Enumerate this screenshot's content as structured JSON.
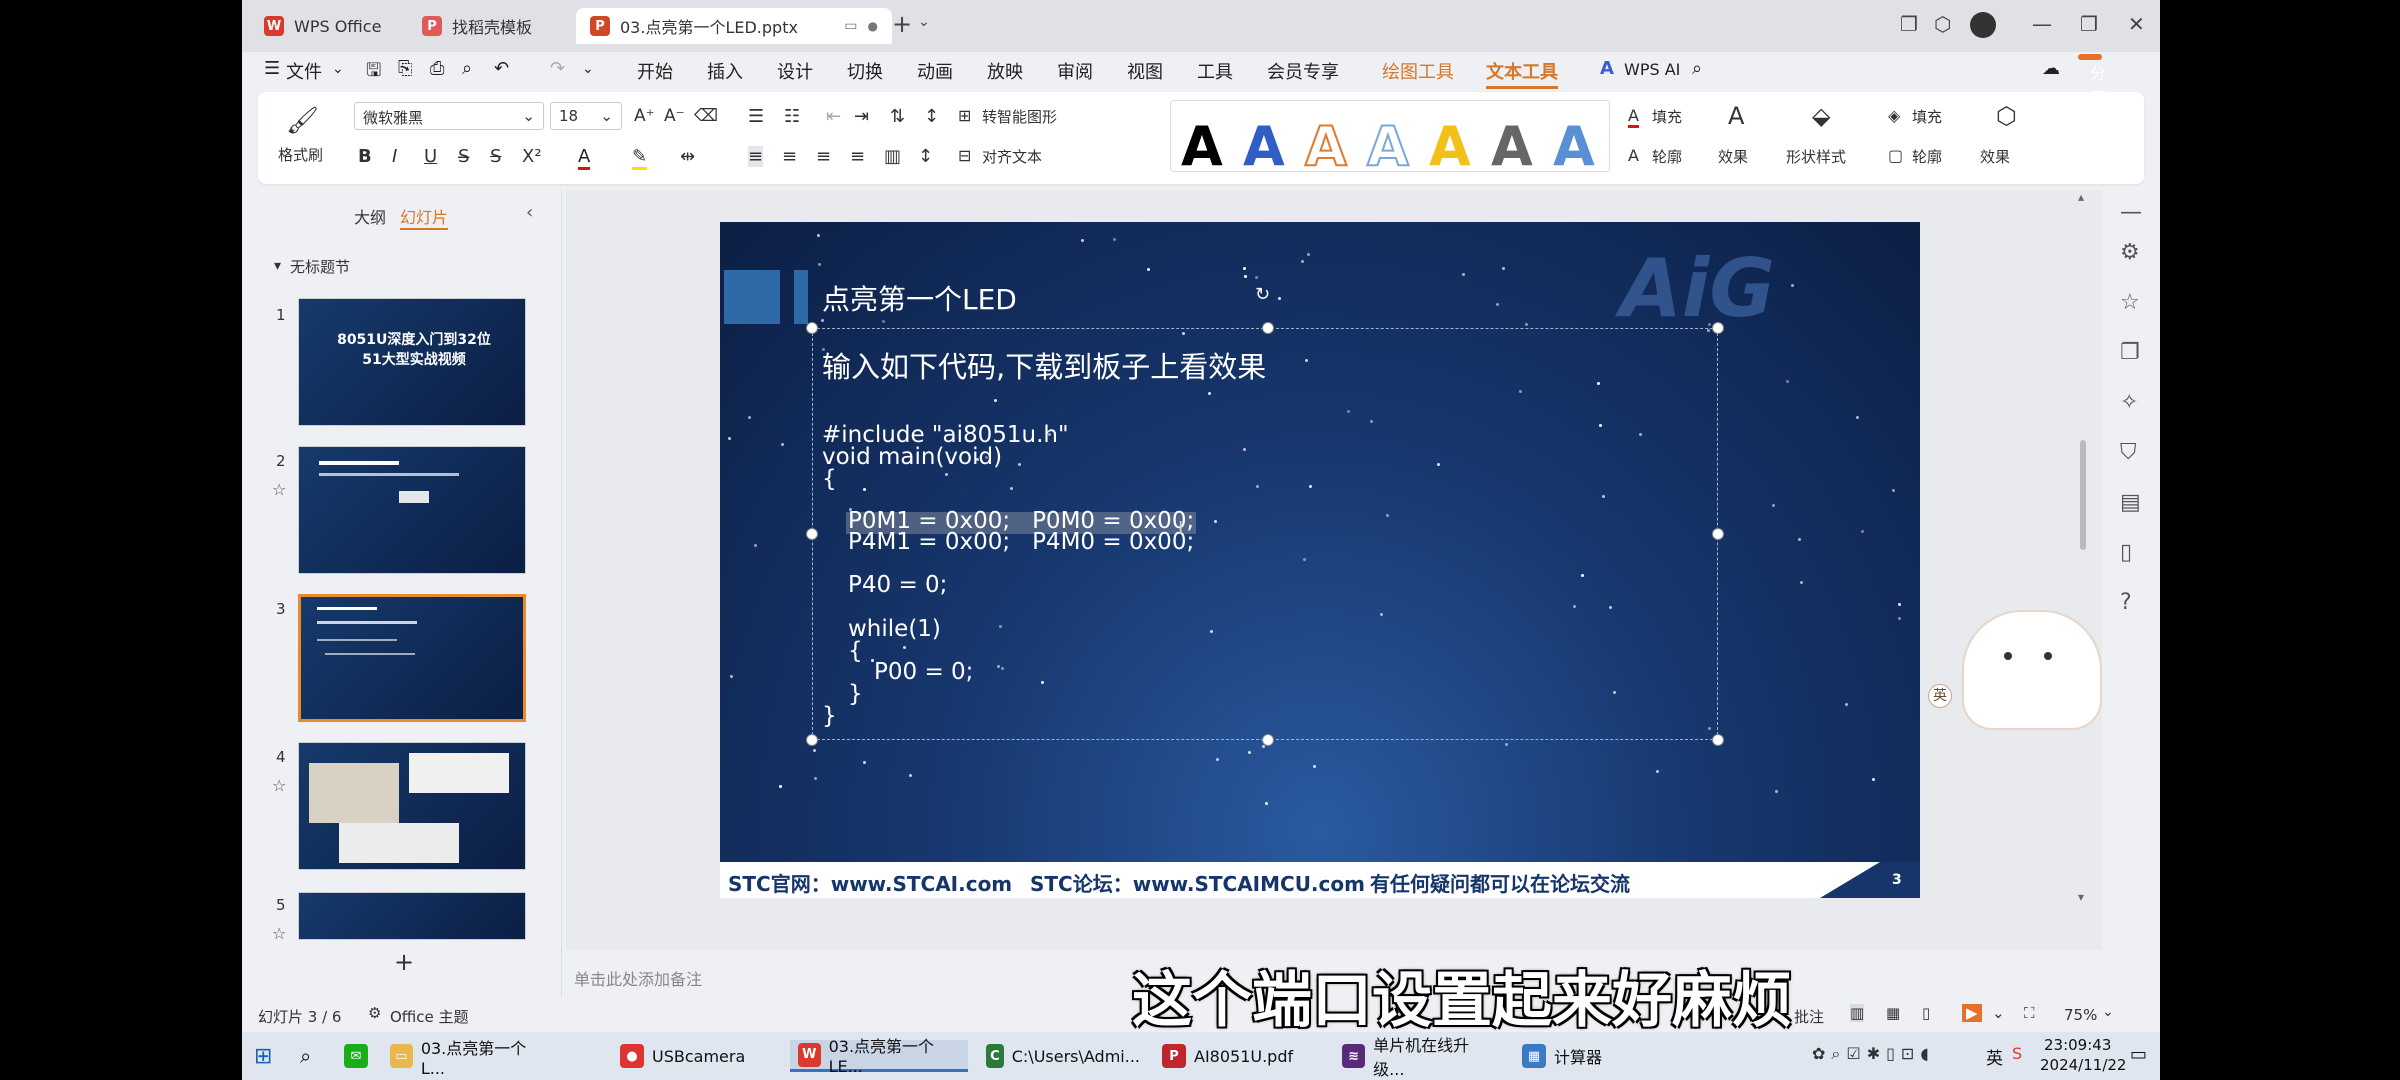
{
  "tabs": [
    {
      "label": "WPS Office"
    },
    {
      "label": "找稻壳模板"
    },
    {
      "label": "03.点亮第一个LED.pptx"
    }
  ],
  "menu": {
    "file": "文件",
    "items": [
      "开始",
      "插入",
      "设计",
      "切换",
      "动画",
      "放映",
      "审阅",
      "视图",
      "工具",
      "会员专享"
    ],
    "drawing_tools": "绘图工具",
    "text_tools": "文本工具",
    "wps_ai": "WPS AI",
    "share": "分享"
  },
  "ribbon": {
    "format_painter": "格式刷",
    "font_name": "微软雅黑",
    "font_size": "18",
    "smart_shape": "转智能图形",
    "align_text": "对齐文本",
    "fill": "填充",
    "outline": "轮廓",
    "effects": "效果",
    "shape_style": "形状样式",
    "fill2": "填充",
    "outline2": "轮廓",
    "effects2": "效果"
  },
  "panel": {
    "outline_tab": "大纲",
    "slides_tab": "幻灯片",
    "section": "无标题节",
    "slide1_title": "8051U深度入门到32位51大型实战视频"
  },
  "slide": {
    "title": "点亮第一个LED",
    "subtitle": "输入如下代码,下载到板子上看效果",
    "code": [
      "#include \"ai8051u.h\"",
      "void main(void)",
      "{",
      "P0M1 = 0x00;   P0M0 = 0x00;",
      "P4M1 = 0x00;   P4M0 = 0x00;",
      "P40 = 0;",
      "while(1)",
      "{",
      "P00 = 0;",
      "}",
      "}"
    ],
    "footer_site": "STC官网：www.STCAI.com",
    "footer_forum": "STC论坛：www.STCAIMCU.com",
    "footer_note": "有任何疑问都可以在论坛交流",
    "page": "3",
    "logo": "AiG"
  },
  "notes_placeholder": "单击此处添加备注",
  "status": {
    "slide_counter": "幻灯片 3 / 6",
    "theme": "Office 主题",
    "comments": "批注",
    "zoom": "75%"
  },
  "taskbar": {
    "items": [
      "03.点亮第一个L...",
      "USBcamera",
      "03.点亮第一个LE...",
      "C:\\Users\\Admi...",
      "AI8051U.pdf",
      "单片机在线升级...",
      "计算器"
    ],
    "ime": "英",
    "time": "23:09:43",
    "date": "2024/11/22"
  },
  "caption": "这个端口设置起来好麻烦"
}
